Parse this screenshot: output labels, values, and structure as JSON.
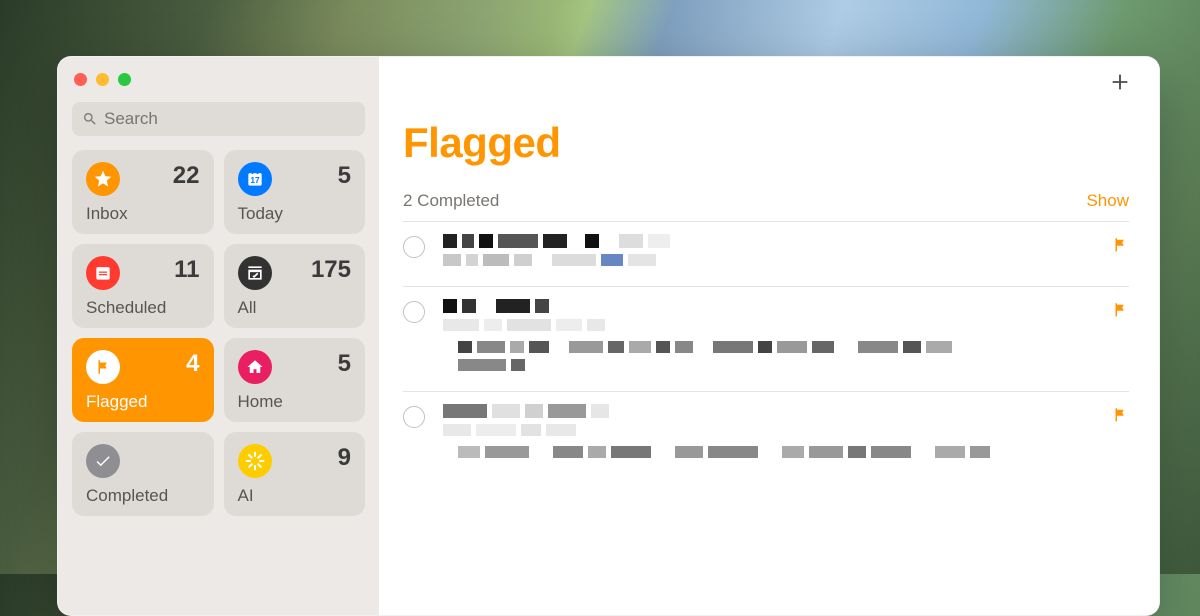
{
  "search": {
    "placeholder": "Search"
  },
  "tiles": [
    {
      "id": "inbox",
      "label": "Inbox",
      "count": "22",
      "icon_bg": "#ff9500",
      "selected": false
    },
    {
      "id": "today",
      "label": "Today",
      "count": "5",
      "icon_bg": "#007aff",
      "selected": false
    },
    {
      "id": "scheduled",
      "label": "Scheduled",
      "count": "11",
      "icon_bg": "#ff3b30",
      "selected": false
    },
    {
      "id": "all",
      "label": "All",
      "count": "175",
      "icon_bg": "#323232",
      "selected": false
    },
    {
      "id": "flagged",
      "label": "Flagged",
      "count": "4",
      "icon_bg": "#ffffff",
      "selected": true
    },
    {
      "id": "home",
      "label": "Home",
      "count": "5",
      "icon_bg": "#ea1e63",
      "selected": false
    },
    {
      "id": "completed",
      "label": "Completed",
      "count": "",
      "icon_bg": "#8e8e93",
      "selected": false
    },
    {
      "id": "ai",
      "label": "AI",
      "count": "9",
      "icon_bg": "#ffcc00",
      "selected": false
    }
  ],
  "main": {
    "title": "Flagged",
    "completed_text": "2 Completed",
    "show_label": "Show"
  }
}
